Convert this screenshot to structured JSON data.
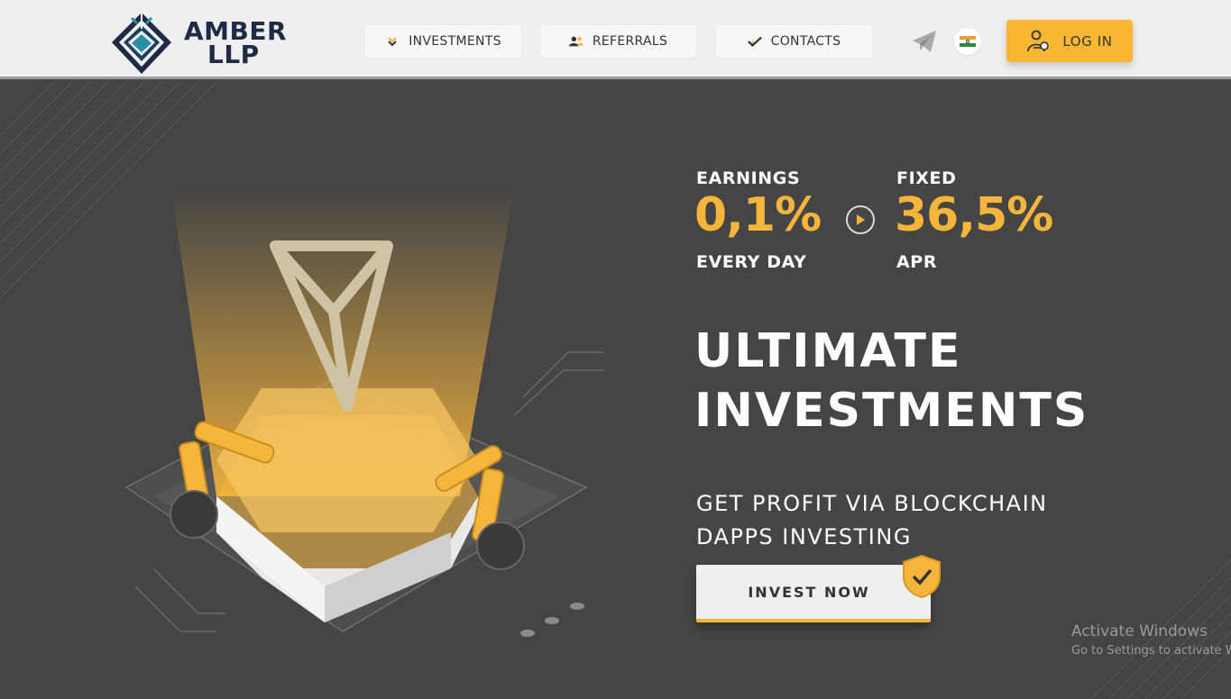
{
  "brand": {
    "name_line1": "AMBER",
    "name_line2": "LLP"
  },
  "nav": {
    "items": [
      {
        "label": "INVESTMENTS",
        "icon": "chevron-down-icon"
      },
      {
        "label": "REFERRALS",
        "icon": "users-icon"
      },
      {
        "label": "CONTACTS",
        "icon": "check-icon"
      }
    ],
    "telegram_icon": "telegram-icon",
    "language_icon": "india-flag-icon",
    "login_label": "LOG IN",
    "login_icon": "user-key-icon"
  },
  "hero": {
    "earnings": {
      "top": "EARNINGS",
      "value": "0,1%",
      "bottom": "EVERY DAY"
    },
    "fixed": {
      "top": "FIXED",
      "value": "36,5%",
      "bottom": "APR"
    },
    "headline": [
      "ULTIMATE",
      "INVESTMENTS"
    ],
    "subline": [
      "GET PROFIT VIA BLOCKCHAIN",
      "DAPPS INVESTING"
    ],
    "cta_label": "INVEST NOW"
  },
  "watermark": {
    "title": "Activate Windows",
    "subtitle": "Go to Settings to activate Windows."
  },
  "colors": {
    "accent": "#f5b53d",
    "header_bg": "#efefef",
    "hero_bg": "#454545",
    "logo_dark": "#1f2a44",
    "logo_teal": "#2b8fa6"
  }
}
